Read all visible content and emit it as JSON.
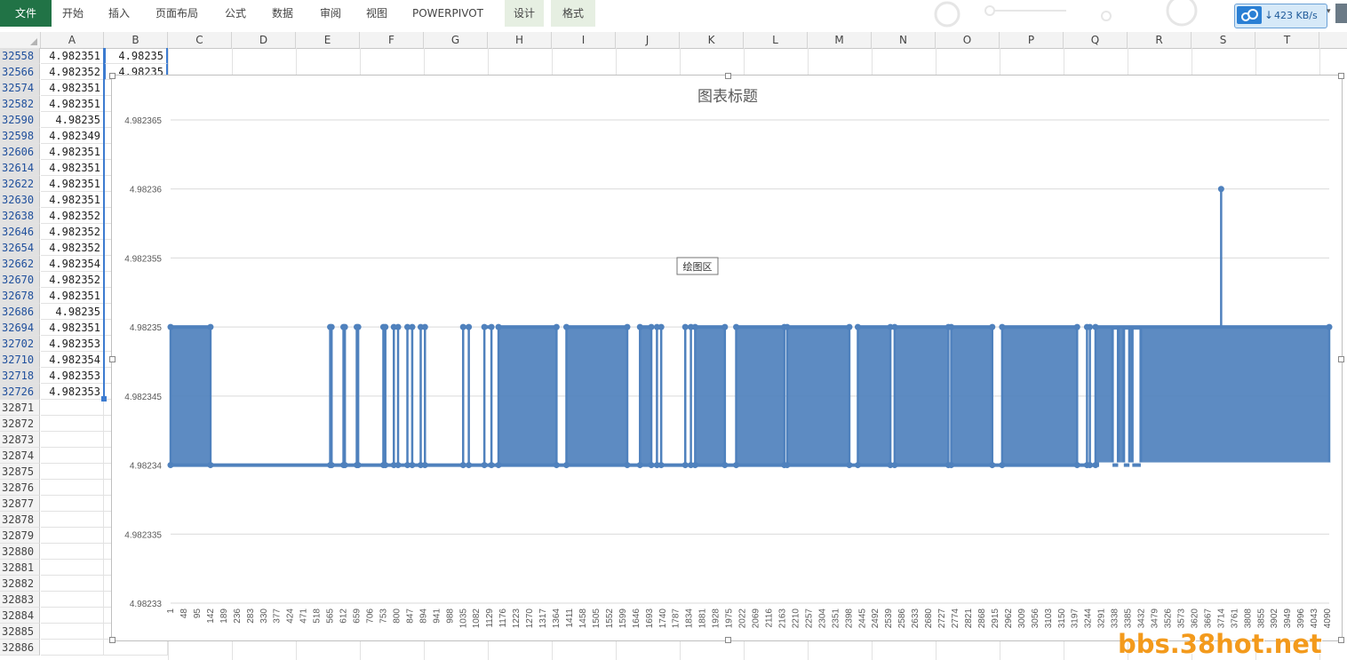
{
  "ribbon": {
    "tabs": [
      {
        "label": "文件",
        "type": "file"
      },
      {
        "label": "开始",
        "type": "normal"
      },
      {
        "label": "插入",
        "type": "normal"
      },
      {
        "label": "页面布局",
        "type": "normal"
      },
      {
        "label": "公式",
        "type": "normal"
      },
      {
        "label": "数据",
        "type": "normal"
      },
      {
        "label": "审阅",
        "type": "normal"
      },
      {
        "label": "视图",
        "type": "normal"
      },
      {
        "label": "POWERPIVOT",
        "type": "normal"
      },
      {
        "label": "设计",
        "type": "context"
      },
      {
        "label": "格式",
        "type": "context"
      }
    ],
    "net_speed": "423 KB/s"
  },
  "columns": [
    "A",
    "B",
    "C",
    "D",
    "E",
    "F",
    "G",
    "H",
    "I",
    "J",
    "K",
    "L",
    "M",
    "N",
    "O",
    "P",
    "Q",
    "R",
    "S",
    "T"
  ],
  "rows": [
    {
      "id": "32558",
      "a": "4.982351",
      "b": "4.98235"
    },
    {
      "id": "32566",
      "a": "4.982352",
      "b": "4.98235"
    },
    {
      "id": "32574",
      "a": "4.982351",
      "b": ""
    },
    {
      "id": "32582",
      "a": "4.982351",
      "b": ""
    },
    {
      "id": "32590",
      "a": "4.98235",
      "b": ""
    },
    {
      "id": "32598",
      "a": "4.982349",
      "b": ""
    },
    {
      "id": "32606",
      "a": "4.982351",
      "b": ""
    },
    {
      "id": "32614",
      "a": "4.982351",
      "b": ""
    },
    {
      "id": "32622",
      "a": "4.982351",
      "b": ""
    },
    {
      "id": "32630",
      "a": "4.982351",
      "b": ""
    },
    {
      "id": "32638",
      "a": "4.982352",
      "b": ""
    },
    {
      "id": "32646",
      "a": "4.982352",
      "b": ""
    },
    {
      "id": "32654",
      "a": "4.982352",
      "b": ""
    },
    {
      "id": "32662",
      "a": "4.982354",
      "b": ""
    },
    {
      "id": "32670",
      "a": "4.982352",
      "b": ""
    },
    {
      "id": "32678",
      "a": "4.982351",
      "b": ""
    },
    {
      "id": "32686",
      "a": "4.98235",
      "b": ""
    },
    {
      "id": "32694",
      "a": "4.982351",
      "b": ""
    },
    {
      "id": "32702",
      "a": "4.982353",
      "b": ""
    },
    {
      "id": "32710",
      "a": "4.982354",
      "b": ""
    },
    {
      "id": "32718",
      "a": "4.982353",
      "b": ""
    },
    {
      "id": "32726",
      "a": "4.982353",
      "b": ""
    },
    {
      "id": "32871",
      "a": "",
      "b": ""
    },
    {
      "id": "32872",
      "a": "",
      "b": ""
    },
    {
      "id": "32873",
      "a": "",
      "b": ""
    },
    {
      "id": "32874",
      "a": "",
      "b": ""
    },
    {
      "id": "32875",
      "a": "",
      "b": ""
    },
    {
      "id": "32876",
      "a": "",
      "b": ""
    },
    {
      "id": "32877",
      "a": "",
      "b": ""
    },
    {
      "id": "32878",
      "a": "",
      "b": ""
    },
    {
      "id": "32879",
      "a": "",
      "b": ""
    },
    {
      "id": "32880",
      "a": "",
      "b": ""
    },
    {
      "id": "32881",
      "a": "",
      "b": ""
    },
    {
      "id": "32882",
      "a": "",
      "b": ""
    },
    {
      "id": "32883",
      "a": "",
      "b": ""
    },
    {
      "id": "32884",
      "a": "",
      "b": ""
    },
    {
      "id": "32885",
      "a": "",
      "b": ""
    },
    {
      "id": "32886",
      "a": "",
      "b": ""
    }
  ],
  "chart_tooltip": "绘图区",
  "watermark": "bbs.38hot.net",
  "colors": {
    "series": "#4f81bd",
    "file_tab": "#217346",
    "context_tab": "#e6efe2",
    "watermark": "#f39a1c"
  },
  "chart_data": {
    "type": "line",
    "title": "图表标题",
    "ylim": [
      4.98233,
      4.982365
    ],
    "yticks": [
      "4.98233",
      "4.982335",
      "4.98234",
      "4.982345",
      "4.98235",
      "4.982355",
      "4.98236",
      "4.982365"
    ],
    "xlim": [
      1,
      4096
    ],
    "xticks": [
      1,
      48,
      95,
      142,
      189,
      236,
      283,
      330,
      377,
      424,
      471,
      518,
      565,
      612,
      659,
      706,
      753,
      800,
      847,
      894,
      941,
      988,
      1035,
      1082,
      1129,
      1176,
      1223,
      1270,
      1317,
      1364,
      1411,
      1458,
      1505,
      1552,
      1599,
      1646,
      1693,
      1740,
      1787,
      1834,
      1881,
      1928,
      1975,
      2022,
      2069,
      2116,
      2163,
      2210,
      2257,
      2304,
      2351,
      2398,
      2445,
      2492,
      2539,
      2586,
      2633,
      2680,
      2727,
      2774,
      2821,
      2868,
      2915,
      2962,
      3009,
      3056,
      3103,
      3150,
      3197,
      3244,
      3291,
      3338,
      3385,
      3432,
      3479,
      3526,
      3573,
      3620,
      3667,
      3714,
      3761,
      3808,
      3855,
      3902,
      3949,
      3996,
      4043,
      4090
    ],
    "low": 4.98234,
    "high": 4.98235,
    "spike": {
      "x": 3714,
      "y": 4.98236
    },
    "high_intervals": [
      [
        1,
        142
      ],
      [
        565,
        570
      ],
      [
        612,
        617
      ],
      [
        659,
        664
      ],
      [
        753,
        760
      ],
      [
        790,
        805
      ],
      [
        838,
        855
      ],
      [
        885,
        900
      ],
      [
        1035,
        1055
      ],
      [
        1110,
        1135
      ],
      [
        1160,
        1365
      ],
      [
        1400,
        1615
      ],
      [
        1660,
        1700
      ],
      [
        1720,
        1735
      ],
      [
        1820,
        1840
      ],
      [
        1855,
        1960
      ],
      [
        2000,
        2170
      ],
      [
        2180,
        2400
      ],
      [
        2430,
        2545
      ],
      [
        2560,
        2750
      ],
      [
        2760,
        2905
      ],
      [
        2940,
        3205
      ],
      [
        3240,
        3250
      ],
      [
        3270,
        4096
      ]
    ],
    "gap_intervals": [
      [
        3330,
        3350
      ],
      [
        3370,
        3390
      ],
      [
        3400,
        3430
      ]
    ]
  }
}
